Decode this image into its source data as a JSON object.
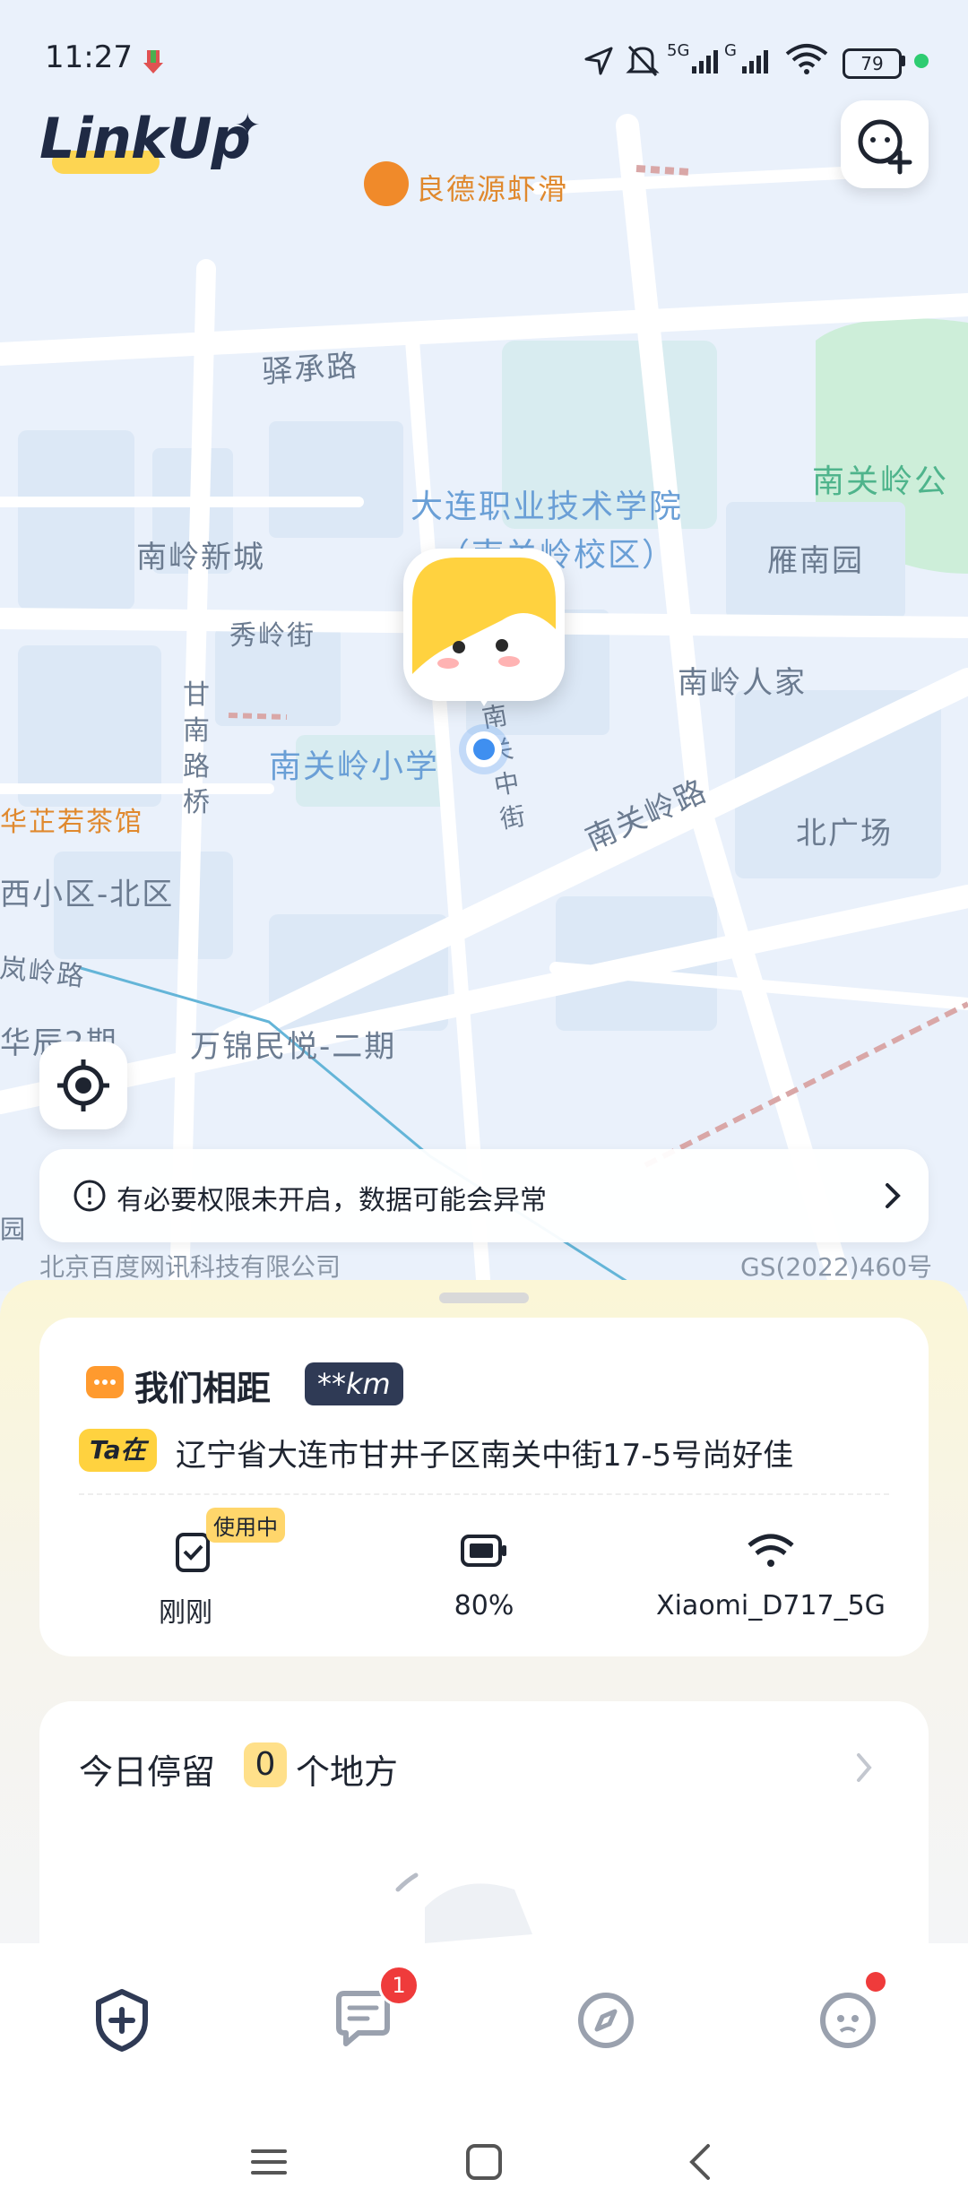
{
  "status_bar": {
    "time": "11:27",
    "battery": "79",
    "network_5g": "5G",
    "network_g": "G"
  },
  "app": {
    "logo": "LinkUp",
    "logo_spark": "✦"
  },
  "map": {
    "labels": {
      "poi_restaurant": "良德源虾滑",
      "road_yicheng": "驿承路",
      "college": "大连职业技术学院",
      "college_campus": "（南关岭校区）",
      "park": "南关岭公",
      "nanling_xincheng": "南岭新城",
      "yannan_yuan": "雁南园",
      "xiuling_jie": "秀岭街",
      "nanling_renjia": "南岭人家",
      "ganan_luqiao": "甘南路桥",
      "nanguanling_school": "南关岭小学",
      "nanguan_zhongjie": "南关中街",
      "nanguanling_lu": "南关岭路",
      "bei_guangchang": "北广场",
      "teahouse": "华芷若茶馆",
      "xi_xiaoqu": "西小区-北区",
      "lanling_lu": "岚岭路",
      "huachen": "华辰2期",
      "wanjin": "万锦民悦-二期",
      "yuan": "园",
      "copyright": "北京百度网讯科技有限公司",
      "license": "GS(2022)460号"
    }
  },
  "permission_banner": {
    "text": "有必要权限未开启，数据可能会异常"
  },
  "distance_card": {
    "title": "我们相距",
    "distance": "**km",
    "ta_badge": "Ta在",
    "address": "辽宁省大连市甘井子区南关中街17-5号尚好佳",
    "in_use_badge": "使用中",
    "stats": [
      {
        "icon": "phone-check-icon",
        "value": "刚刚"
      },
      {
        "icon": "battery-icon",
        "value": "80%"
      },
      {
        "icon": "wifi-icon",
        "value": "Xiaomi_D717_5G"
      }
    ]
  },
  "stay_card": {
    "title_prefix": "今日停留",
    "count": "0",
    "title_suffix": "个地方"
  },
  "bottom_nav": {
    "messages_badge": "1",
    "items": [
      "home-shield-icon",
      "chat-icon",
      "compass-icon",
      "profile-face-icon"
    ]
  },
  "colors": {
    "accent_yellow": "#ffd23f",
    "dark_navy": "#2f3a55",
    "badge_red": "#ef3b3b",
    "map_green": "#cdeed9"
  }
}
